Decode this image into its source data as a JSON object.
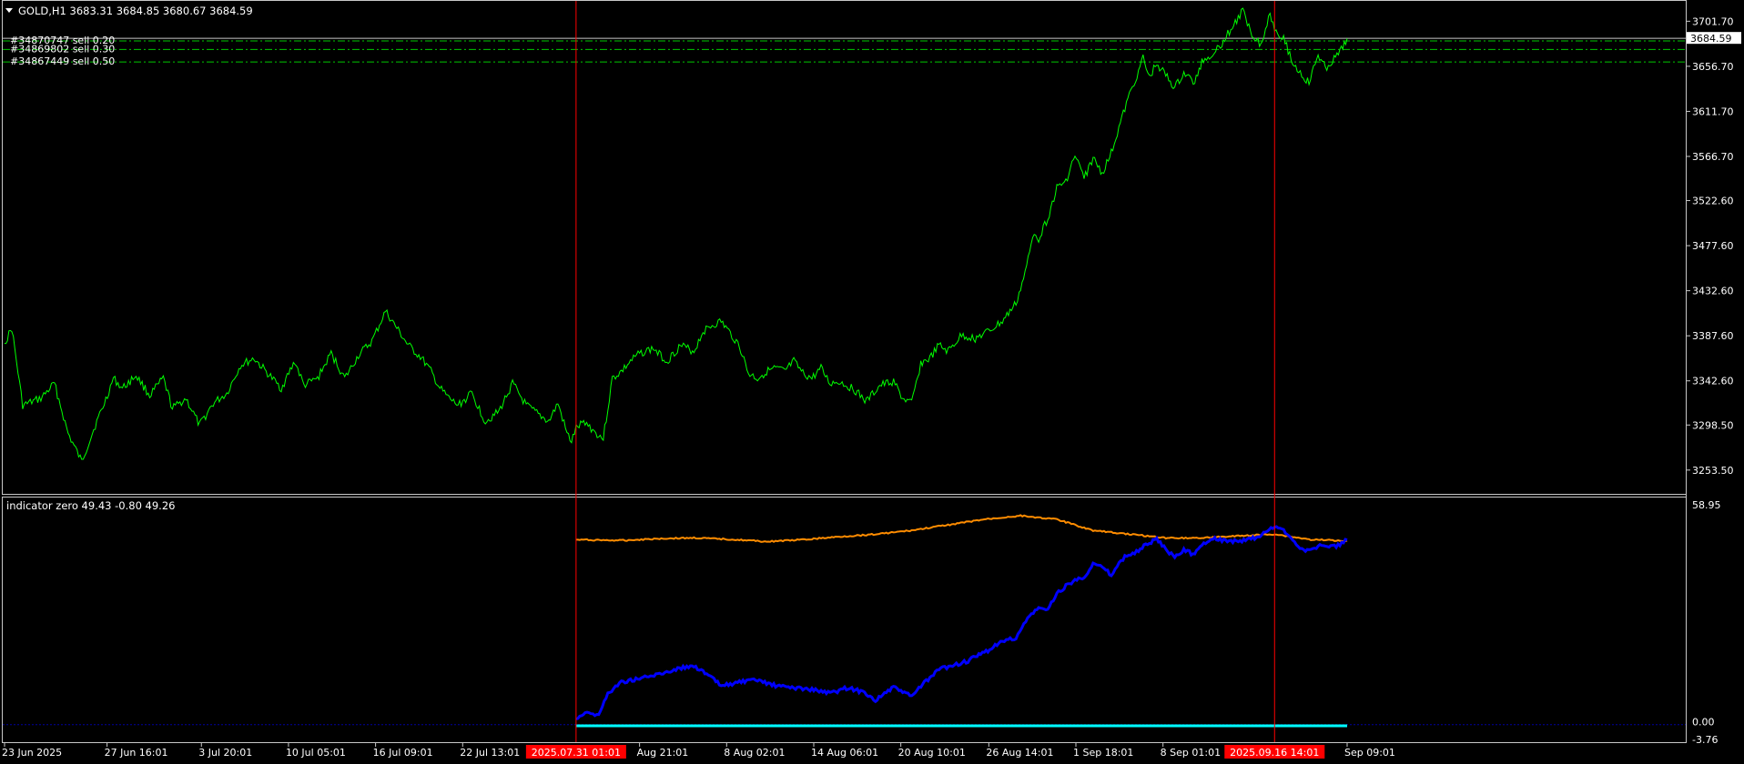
{
  "colors": {
    "background": "#000000",
    "frame": "#c8c8c8",
    "price_line": "#00ff00",
    "order_line": "#00c800",
    "vline": "#ff0000",
    "ind_orange": "#ff8c00",
    "ind_blue": "#0000ff",
    "ind_cyan": "#00ffff",
    "ind_zero": "#0000a0",
    "marker_bg": "#ff0000",
    "price_label_bg": "#ffffff",
    "price_label_text": "#000000"
  },
  "main": {
    "title": "GOLD,H1  3683.31 3684.85 3680.67 3684.59",
    "current_price": "3684.59",
    "orders": [
      {
        "label": "#34870747 sell 0.20",
        "price": 3682.0
      },
      {
        "label": "#34869802 sell 0.30",
        "price": 3673.5
      },
      {
        "label": "#34867449 sell 0.50",
        "price": 3661.0
      }
    ]
  },
  "indicator": {
    "title": "indicator zero 49.43 -0.80 49.26",
    "axis_labels": [
      {
        "label": "58.95",
        "value": 58.95
      },
      {
        "label": "0.00",
        "value": 0.0
      },
      {
        "label": "-3.76",
        "value": -3.76
      }
    ]
  },
  "time_axis": {
    "labels": [
      {
        "label": "23 Jun 2025",
        "t": 0
      },
      {
        "label": "27 Jun 16:01",
        "t": 113
      },
      {
        "label": "3 Jul 20:01",
        "t": 217
      },
      {
        "label": "10 Jul 05:01",
        "t": 313
      },
      {
        "label": "16 Jul 09:01",
        "t": 409
      },
      {
        "label": "22 Jul 13:01",
        "t": 505
      },
      {
        "label": "Aug 21:01",
        "t": 700
      },
      {
        "label": "8 Aug 02:01",
        "t": 796
      },
      {
        "label": "14 Aug 06:01",
        "t": 892
      },
      {
        "label": "20 Aug 10:01",
        "t": 988
      },
      {
        "label": "26 Aug 14:01",
        "t": 1085
      },
      {
        "label": "1 Sep 18:01",
        "t": 1181
      },
      {
        "label": "8 Sep 01:01",
        "t": 1277
      },
      {
        "label": "Sep 09:01",
        "t": 1480
      }
    ],
    "markers": [
      {
        "label": "2025.07.31 01:01",
        "t": 630
      },
      {
        "label": "2025.09.16 14:01",
        "t": 1400
      }
    ]
  },
  "chart_data": [
    {
      "type": "line",
      "title": "GOLD,H1",
      "x_unit": "H1 bar index",
      "x_range": [
        0,
        1480
      ],
      "ylim": [
        3237.0,
        3712.0
      ],
      "y_ticks": [
        3701.7,
        3656.7,
        3611.7,
        3566.7,
        3522.6,
        3477.6,
        3432.6,
        3387.6,
        3342.6,
        3298.5,
        3253.5
      ],
      "series": [
        {
          "x": [
            0,
            8,
            20,
            40,
            55,
            70,
            85,
            100,
            110,
            120,
            130,
            145,
            160,
            175,
            185,
            200,
            215,
            230,
            245,
            260,
            275,
            290,
            305,
            320,
            330,
            345,
            360,
            375,
            390,
            405,
            420,
            445,
            460,
            470,
            480,
            490,
            500,
            515,
            530,
            545,
            560,
            575,
            590,
            600,
            610,
            620,
            625,
            630,
            640,
            650,
            660,
            670,
            680,
            690,
            700,
            715,
            730,
            745,
            760,
            770,
            780,
            790,
            800,
            810,
            820,
            830,
            840,
            850,
            860,
            870,
            880,
            890,
            900,
            910,
            920,
            935,
            950,
            965,
            980,
            990,
            1000,
            1010,
            1020,
            1030,
            1040,
            1055,
            1070,
            1085,
            1100,
            1115,
            1125,
            1135,
            1140,
            1150,
            1160,
            1170,
            1180,
            1190,
            1200,
            1210,
            1220,
            1230,
            1240,
            1250,
            1255,
            1262,
            1270,
            1280,
            1290,
            1300,
            1312,
            1320,
            1330,
            1342,
            1355,
            1365,
            1375,
            1385,
            1395,
            1400,
            1410,
            1420,
            1430,
            1438,
            1448,
            1456,
            1464,
            1472,
            1480
          ],
          "y": [
            3380,
            3395,
            3318,
            3325,
            3340,
            3290,
            3262,
            3298,
            3320,
            3345,
            3335,
            3348,
            3328,
            3345,
            3315,
            3325,
            3298,
            3320,
            3330,
            3358,
            3365,
            3350,
            3335,
            3362,
            3338,
            3345,
            3370,
            3345,
            3368,
            3382,
            3412,
            3378,
            3365,
            3352,
            3335,
            3325,
            3318,
            3330,
            3302,
            3312,
            3340,
            3318,
            3308,
            3302,
            3320,
            3290,
            3282,
            3295,
            3302,
            3292,
            3285,
            3345,
            3352,
            3362,
            3370,
            3375,
            3362,
            3378,
            3372,
            3392,
            3398,
            3402,
            3390,
            3378,
            3350,
            3345,
            3352,
            3355,
            3352,
            3362,
            3350,
            3345,
            3355,
            3340,
            3342,
            3335,
            3322,
            3338,
            3342,
            3325,
            3320,
            3360,
            3365,
            3378,
            3372,
            3388,
            3385,
            3392,
            3402,
            3420,
            3450,
            3492,
            3485,
            3505,
            3535,
            3542,
            3568,
            3545,
            3565,
            3550,
            3570,
            3600,
            3628,
            3652,
            3665,
            3645,
            3660,
            3648,
            3635,
            3650,
            3640,
            3662,
            3668,
            3680,
            3698,
            3712,
            3690,
            3678,
            3710,
            3695,
            3685,
            3660,
            3648,
            3640,
            3668,
            3655,
            3662,
            3670,
            3684.59
          ]
        }
      ]
    },
    {
      "type": "line",
      "title": "indicator zero 49.43 -0.80 49.26",
      "x_unit": "H1 bar index",
      "x_range": [
        0,
        1480
      ],
      "ylim": [
        -3.76,
        58.95
      ],
      "series": [
        {
          "color": "orange",
          "x": [
            630,
            680,
            720,
            760,
            800,
            840,
            880,
            920,
            960,
            1000,
            1040,
            1080,
            1120,
            1160,
            1200,
            1240,
            1280,
            1320,
            1360,
            1400,
            1440,
            1480
          ],
          "y": [
            49.5,
            49.3,
            49.8,
            50.0,
            49.6,
            49.0,
            49.5,
            50.3,
            51.0,
            52.0,
            53.5,
            55.0,
            56.0,
            55.0,
            52.0,
            51.0,
            50.0,
            50.0,
            50.5,
            51.0,
            49.5,
            49.26
          ]
        },
        {
          "color": "blue",
          "x": [
            630,
            640,
            655,
            665,
            680,
            700,
            720,
            740,
            760,
            780,
            790,
            810,
            830,
            850,
            870,
            890,
            910,
            930,
            950,
            960,
            970,
            980,
            990,
            1000,
            1010,
            1020,
            1030,
            1045,
            1060,
            1080,
            1100,
            1115,
            1130,
            1140,
            1150,
            1160,
            1170,
            1180,
            1190,
            1200,
            1210,
            1220,
            1235,
            1250,
            1260,
            1270,
            1280,
            1290,
            1300,
            1310,
            1320,
            1330,
            1340,
            1360,
            1380,
            1400,
            1410,
            1420,
            1430,
            1440,
            1450,
            1460,
            1470,
            1480
          ],
          "y": [
            1.0,
            3.0,
            2.0,
            8.0,
            11.0,
            12.0,
            13.0,
            14.5,
            15.5,
            12.0,
            10.0,
            11.0,
            11.5,
            10.0,
            9.5,
            9.0,
            8.0,
            9.5,
            8.0,
            6.0,
            8.0,
            9.5,
            8.5,
            7.0,
            10.0,
            12.0,
            14.5,
            15.5,
            16.5,
            19.0,
            22.0,
            23.0,
            29.0,
            31.0,
            30.5,
            35.0,
            37.0,
            38.5,
            39.5,
            43.0,
            42.0,
            40.0,
            45.0,
            46.5,
            48.5,
            49.5,
            47.0,
            44.5,
            47.0,
            45.5,
            48.0,
            50.0,
            49.5,
            49.0,
            50.0,
            53.0,
            52.0,
            49.5,
            47.0,
            46.5,
            48.0,
            47.5,
            48.0,
            49.43
          ]
        },
        {
          "color": "cyan",
          "x": [
            630,
            1480
          ],
          "y": [
            -0.8,
            -0.8
          ]
        }
      ]
    }
  ]
}
